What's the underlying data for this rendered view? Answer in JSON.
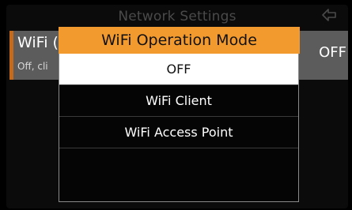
{
  "header": {
    "title": "Network Settings",
    "back_icon": "back-arrow-icon"
  },
  "background_item": {
    "label": "WiFi (",
    "sublabel": "Off, cli",
    "value": "OFF"
  },
  "dialog": {
    "title": "WiFi Operation Mode",
    "options": [
      {
        "label": "OFF",
        "selected": true
      },
      {
        "label": "WiFi Client",
        "selected": false
      },
      {
        "label": "WiFi Access Point",
        "selected": false
      },
      {
        "label": "",
        "selected": false
      }
    ]
  },
  "colors": {
    "accent_orange": "#f39a2e",
    "row_accent": "#c46a1a",
    "selected_bg": "#ffffff"
  }
}
